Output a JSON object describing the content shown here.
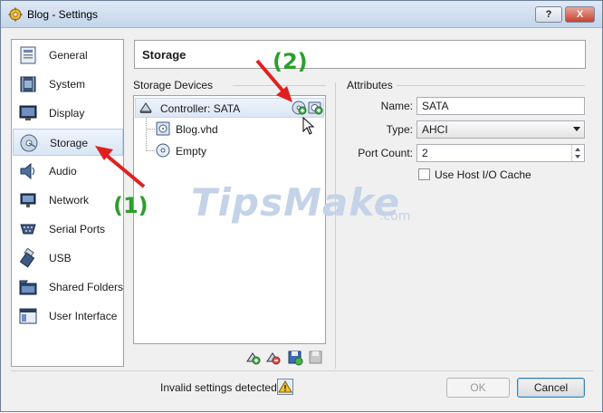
{
  "window": {
    "title": "Blog - Settings",
    "help_label": "?",
    "close_label": "X"
  },
  "sidebar": {
    "items": [
      {
        "label": "General",
        "icon": "general-icon"
      },
      {
        "label": "System",
        "icon": "system-icon"
      },
      {
        "label": "Display",
        "icon": "display-icon"
      },
      {
        "label": "Storage",
        "icon": "storage-icon",
        "selected": true
      },
      {
        "label": "Audio",
        "icon": "audio-icon"
      },
      {
        "label": "Network",
        "icon": "network-icon"
      },
      {
        "label": "Serial Ports",
        "icon": "serial-ports-icon"
      },
      {
        "label": "USB",
        "icon": "usb-icon"
      },
      {
        "label": "Shared Folders",
        "icon": "shared-folders-icon"
      },
      {
        "label": "User Interface",
        "icon": "user-interface-icon"
      }
    ]
  },
  "header": {
    "title": "Storage"
  },
  "storage": {
    "group_label": "Storage Devices",
    "controller": "Controller: SATA",
    "children": [
      "Blog.vhd",
      "Empty"
    ]
  },
  "attributes": {
    "group_label": "Attributes",
    "name_label": "Name:",
    "name_value": "SATA",
    "type_label": "Type:",
    "type_value": "AHCI",
    "port_count_label": "Port Count:",
    "port_count_value": "2",
    "host_cache_label": "Use Host I/O Cache",
    "host_cache_checked": false
  },
  "footer": {
    "status": "Invalid settings detected",
    "ok_label": "OK",
    "cancel_label": "Cancel"
  },
  "annotations": {
    "step1": "(1)",
    "step2": "(2)",
    "arrow_color": "#e02020",
    "label_color": "#2aa02a"
  },
  "watermark": {
    "text": "TipsMake",
    "suffix": ".com"
  }
}
